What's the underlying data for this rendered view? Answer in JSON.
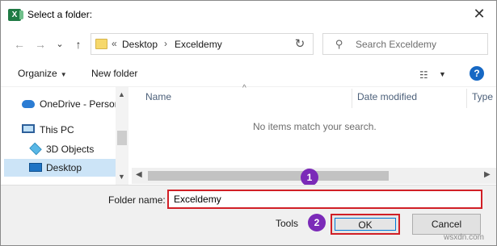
{
  "window": {
    "title": "Select a folder:",
    "app_icon_letter": "X",
    "close_glyph": "✕"
  },
  "nav": {
    "back_glyph": "←",
    "forward_glyph": "→",
    "recent_glyph": "⌄",
    "up_glyph": "↑",
    "address": {
      "prefix": "«",
      "crumbs": [
        "Desktop",
        "Exceldemy"
      ],
      "separator": "›",
      "dropdown_glyph": "⌄",
      "refresh_glyph": "↻"
    },
    "search": {
      "placeholder": "Search Exceldemy",
      "icon_glyph": "⚲"
    }
  },
  "toolbar": {
    "organize_label": "Organize",
    "organize_caret": "▼",
    "new_folder_label": "New folder",
    "view_glyph": "☷",
    "view_caret": "▼",
    "help_glyph": "?"
  },
  "navpane": {
    "items": [
      {
        "label": "OneDrive - Person",
        "icon": "onedrive-icon"
      },
      {
        "label": "This PC",
        "icon": "pc-icon"
      },
      {
        "label": "3D Objects",
        "icon": "cube-icon"
      },
      {
        "label": "Desktop",
        "icon": "desktop-icon",
        "selected": true
      }
    ],
    "scroll_up": "▲",
    "scroll_down": "▼"
  },
  "filepane": {
    "columns": [
      "Name",
      "Date modified",
      "Type"
    ],
    "sort_glyph": "^",
    "empty_message": "No items match your search.",
    "scroll_left": "◀",
    "scroll_right": "▶"
  },
  "badges": [
    "1",
    "2"
  ],
  "bottom": {
    "folder_name_label": "Folder name:",
    "folder_name_value": "Exceldemy",
    "tools_label": "Tools",
    "tools_caret": "▼",
    "ok_label": "OK",
    "cancel_label": "Cancel"
  },
  "watermark": "wsxdn.com",
  "colors": {
    "highlight_red": "#d11f26",
    "badge_purple": "#7b2ab8",
    "selection_blue": "#cce4f7",
    "help_blue": "#1668c4"
  }
}
